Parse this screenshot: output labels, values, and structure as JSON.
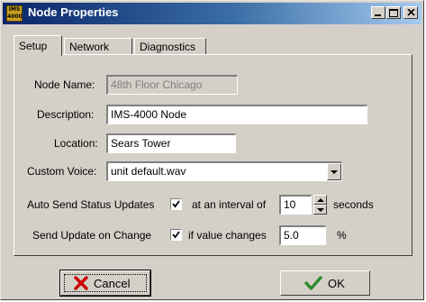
{
  "window": {
    "title": "Node Properties",
    "app_icon_text_top": "IMS",
    "app_icon_text_bottom": "4000"
  },
  "tabs": [
    {
      "label": "Setup",
      "active": true
    },
    {
      "label": "Network",
      "active": false
    },
    {
      "label": "Diagnostics",
      "active": false
    }
  ],
  "form": {
    "node_name_label": "Node Name:",
    "node_name_value": "48th Floor Chicago",
    "description_label": "Description:",
    "description_value": "IMS-4000 Node",
    "location_label": "Location:",
    "location_value": "Sears Tower",
    "custom_voice_label": "Custom Voice:",
    "custom_voice_value": "unit default.wav",
    "auto_send_label": "Auto Send Status Updates",
    "auto_send_checked": true,
    "interval_label": "at an interval of",
    "interval_value": "10",
    "interval_unit": "seconds",
    "update_change_label": "Send Update on Change",
    "update_change_checked": true,
    "value_changes_label": "if value changes",
    "value_changes_value": "5.0",
    "value_changes_unit": "%"
  },
  "buttons": {
    "cancel_label": "Cancel",
    "ok_label": "OK"
  },
  "colors": {
    "titlebar_start": "#0a246a",
    "titlebar_end": "#a6caf0",
    "face": "#d4d0c8",
    "cancel_icon": "#cc0000",
    "ok_icon": "#2e8b2e"
  }
}
